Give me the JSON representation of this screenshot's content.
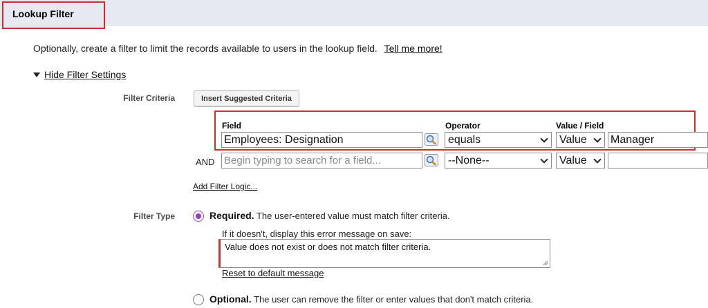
{
  "section": {
    "title": "Lookup Filter"
  },
  "intro": {
    "text": "Optionally, create a filter to limit the records available to users in the lookup field.",
    "link": "Tell me more!"
  },
  "toggle": {
    "label": "Hide Filter Settings"
  },
  "filter_criteria": {
    "label": "Filter Criteria",
    "insert_button": "Insert Suggested Criteria",
    "columns": {
      "field": "Field",
      "operator": "Operator",
      "value": "Value / Field"
    },
    "rows": [
      {
        "connector": "",
        "field_value": "Employees: Designation",
        "field_placeholder": "",
        "operator": "equals",
        "value_type": "Value",
        "value": "Manager"
      },
      {
        "connector": "AND",
        "field_value": "",
        "field_placeholder": "Begin typing to search for a field...",
        "operator": "--None--",
        "value_type": "Value",
        "value": ""
      }
    ],
    "add_logic_link": "Add Filter Logic..."
  },
  "filter_type": {
    "label": "Filter Type",
    "required": {
      "title": "Required.",
      "description": "The user-entered value must match filter criteria.",
      "selected": true
    },
    "error_prompt": "If it doesn't, display this error message on save:",
    "error_message": "Value does not exist or does not match filter criteria.",
    "reset_link": "Reset to default message",
    "optional": {
      "title": "Optional.",
      "description": "The user can remove the filter or enter values that don't match criteria.",
      "selected": false
    }
  },
  "colors": {
    "highlight_red": "#d12c2c",
    "radio_purple": "#9a3fc2",
    "header_bg": "#e6e8f2"
  }
}
